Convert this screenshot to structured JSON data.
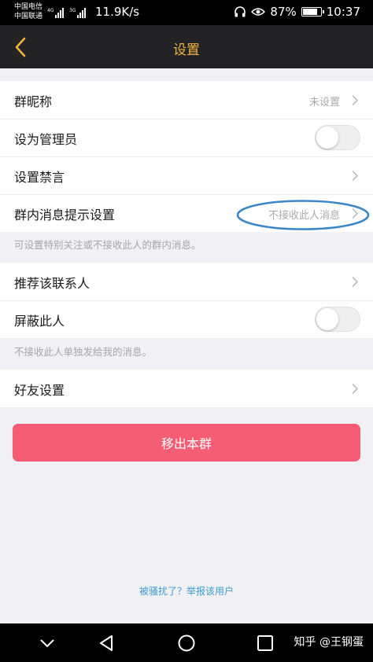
{
  "status_bar": {
    "carrier_1": "中国电信",
    "carrier_2": "中国联通",
    "net_speed": "11.9K/s",
    "battery": "87%",
    "battery_level": 0.87,
    "time": "10:37",
    "icons": [
      "signal-4g-icon",
      "signal-3g-icon",
      "headphone-icon",
      "eye-icon",
      "battery-icon"
    ]
  },
  "header": {
    "title": "设置"
  },
  "group1": {
    "nickname_label": "群昵称",
    "nickname_value": "未设置",
    "admin_label": "设为管理员",
    "admin_on": false,
    "mute_label": "设置禁言",
    "notify_label": "群内消息提示设置",
    "notify_value": "不接收此人消息"
  },
  "hint1": "可设置特别关注或不接收此人的群内消息。",
  "group2": {
    "recommend_label": "推荐该联系人",
    "block_label": "屏蔽此人",
    "block_on": false
  },
  "hint2": "不接收此人单独发给我的消息。",
  "group3": {
    "friend_settings_label": "好友设置"
  },
  "leave_button": "移出本群",
  "report_link": "被骚扰了？举报该用户",
  "watermark": "知乎 @王钢蛋",
  "colors": {
    "accent": "#f0b443",
    "nav_bg": "#232325",
    "danger": "#f45d74",
    "link": "#3c9bd0",
    "annotation": "#3a86c8"
  }
}
